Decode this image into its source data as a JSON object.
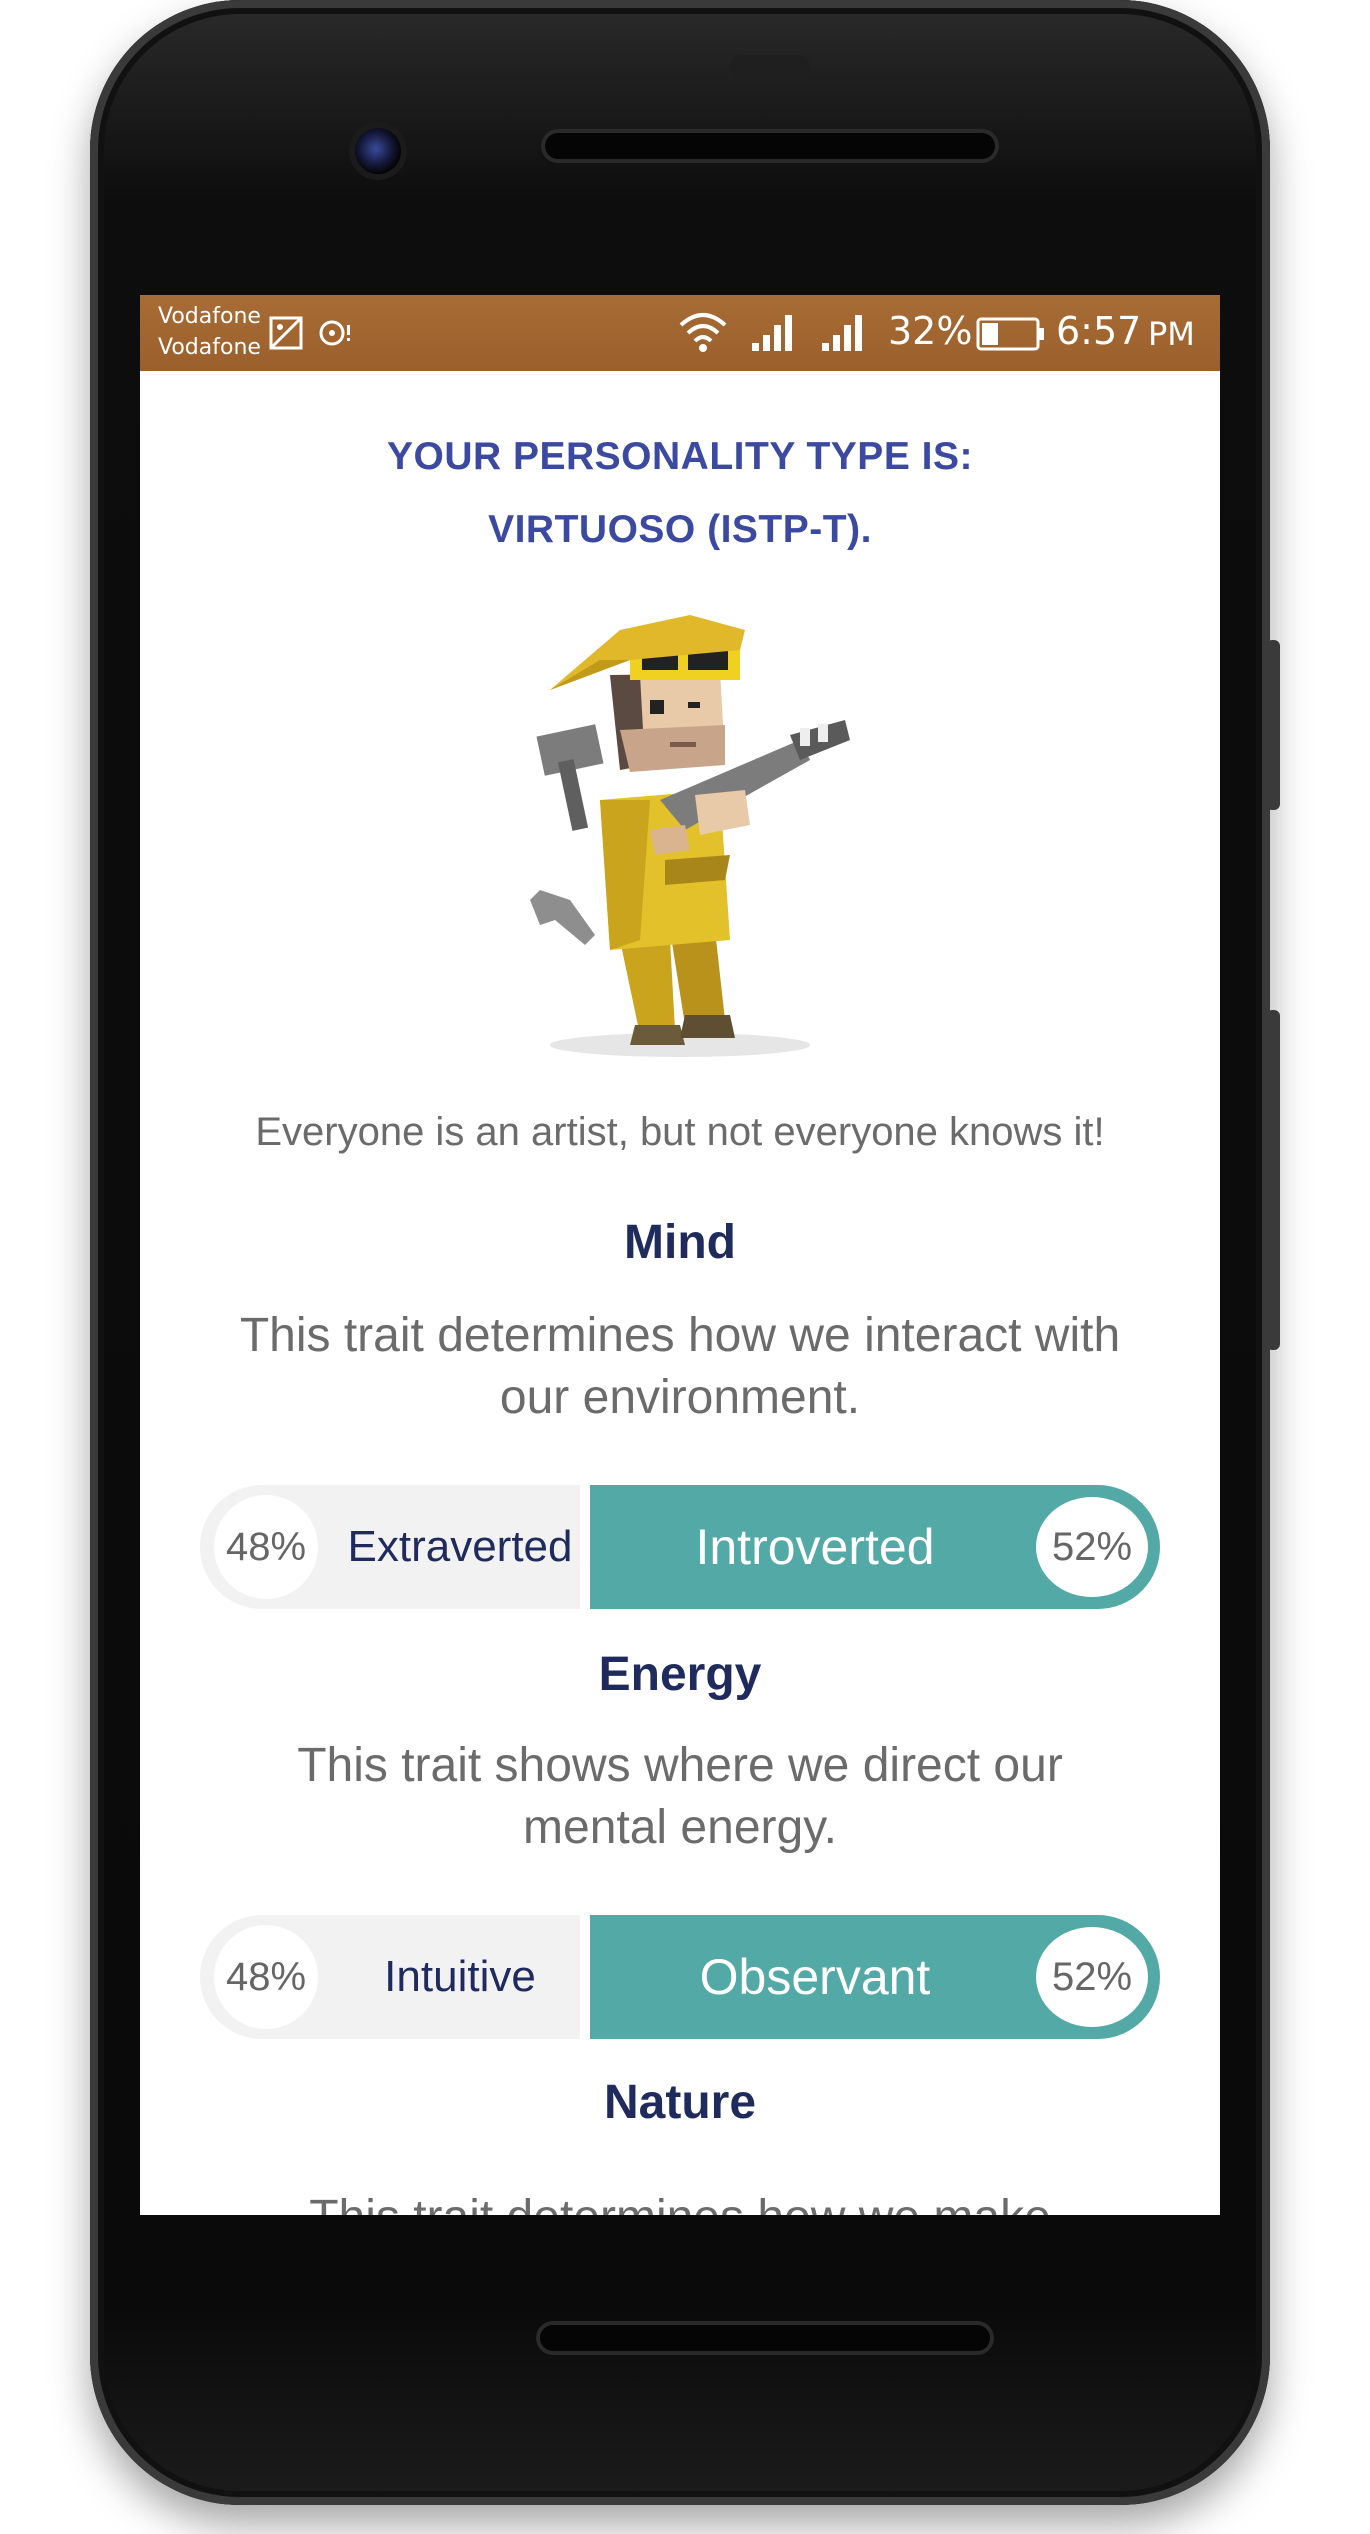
{
  "statusbar": {
    "carrier1": "Vodafone",
    "carrier2": "Vodafone",
    "battery": "32%",
    "time": "6:57",
    "ampm": "PM"
  },
  "header": {
    "line1": "YOUR PERSONALITY TYPE IS:",
    "line2": "VIRTUOSO (ISTP-T)."
  },
  "quote": "Everyone is an artist, but not everyone knows it!",
  "traits": [
    {
      "title": "Mind",
      "desc_line1": "This trait determines how we interact with",
      "desc_line2": "our environment.",
      "left_pct": "48%",
      "left_label": "Extraverted",
      "right_label": "Introverted",
      "right_pct": "52%",
      "right_value": 52
    },
    {
      "title": "Energy",
      "desc_line1": "This trait shows where we direct our",
      "desc_line2": "mental energy.",
      "left_pct": "48%",
      "left_label": "Intuitive",
      "right_label": "Observant",
      "right_pct": "52%",
      "right_value": 52
    },
    {
      "title": "Nature",
      "desc_partial": "This trait determines how we make"
    }
  ],
  "colors": {
    "statusbar": "#a0652f",
    "title": "#3b4aa0",
    "heading": "#1f2b5c",
    "accent": "#52a9a6"
  },
  "icons": [
    "image-notification-icon",
    "sync-icon",
    "wifi-icon",
    "signal-icon",
    "battery-icon"
  ]
}
